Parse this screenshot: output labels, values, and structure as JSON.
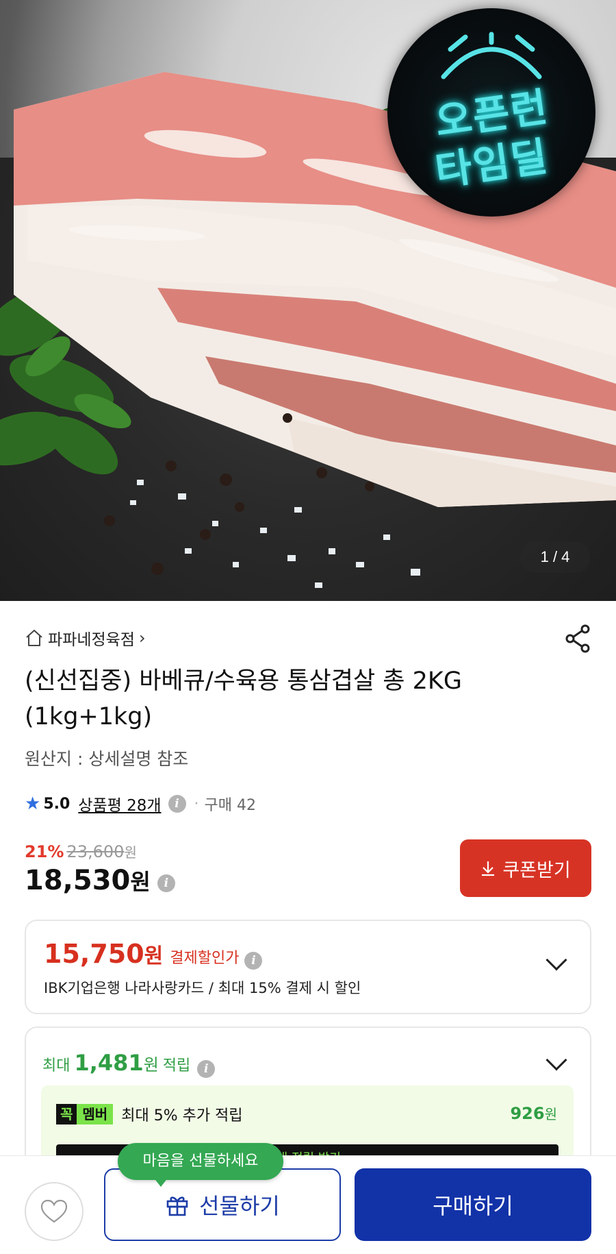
{
  "hero": {
    "badge_line1": "오픈런",
    "badge_line2": "타임딜",
    "pager": "1 / 4"
  },
  "store": {
    "name": "파파네정육점",
    "chevron": "›"
  },
  "product": {
    "title": "(신선집중) 바베큐/수육용 통삼겹살 총 2KG (1kg+1kg)",
    "origin": "원산지 : 상세설명 참조"
  },
  "rating": {
    "score": "5.0",
    "reviews": "상품평 28개",
    "purchases": "구매 42"
  },
  "price": {
    "discount_pct": "21%",
    "original": "23,600",
    "original_unit": "원",
    "sale": "18,530",
    "sale_unit": "원"
  },
  "coupon": {
    "label": "쿠폰받기"
  },
  "payment_discount": {
    "price": "15,750",
    "unit": "원",
    "tag": "결제할인가",
    "detail": "IBK기업은행 나라사랑카드 / 최대 15% 결제 시 할인"
  },
  "points": {
    "prefix": "최대",
    "amount": "1,481",
    "unit": "원",
    "suffix": "적립",
    "member_logo_a": "꼭",
    "member_logo_b": "멤버",
    "member_text": "최대 5% 추가 적립",
    "member_amount": "926",
    "member_unit": "원",
    "member_bar": "최대 적립 받기 ›"
  },
  "bottom": {
    "bubble": "마음을 선물하세요",
    "gift_label": "선물하기",
    "buy_label": "구매하기"
  },
  "colors": {
    "accent_red": "#d73325",
    "primary_blue": "#1232a8",
    "green": "#2f9e44",
    "neon": "#58e3e6"
  },
  "icons": [
    "home-icon",
    "chevron-right-icon",
    "share-icon",
    "star-icon",
    "info-icon",
    "download-icon",
    "chevron-down-icon",
    "heart-icon",
    "gift-icon",
    "alarm-clock-icon"
  ]
}
